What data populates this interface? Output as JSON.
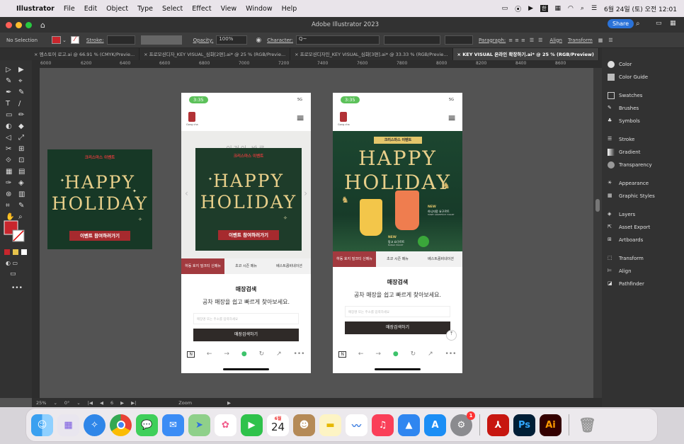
{
  "menubar": {
    "app": "Illustrator",
    "items": [
      "File",
      "Edit",
      "Object",
      "Type",
      "Select",
      "Effect",
      "View",
      "Window",
      "Help"
    ],
    "datetime": "6월 24일 (토) 오전 12:01"
  },
  "titlebar": {
    "title": "Adobe Illustrator 2023",
    "share": "Share"
  },
  "control": {
    "selection": "No Selection",
    "stroke": "Stroke:",
    "opacity_label": "Opacity:",
    "opacity": "100%",
    "character": "Character:",
    "char_search": "Q~",
    "paragraph": "Paragraph:",
    "align": "Align",
    "transform": "Transform"
  },
  "tabs": [
    "엠스토어 로고.ai @ 66.91 % (CMYK/Previe...",
    "프로모션디자_KEY VISUAL_심화[2편].ai* @ 25 % (RGB/Previe...",
    "프로모션디자인_KEY VISUAL_심화[3편].ai* @ 33.33 % (RGB/Previe...",
    "KEY VISUAL 온라인 확장하기.ai* @ 25 % (RGB/Preview)"
  ],
  "ruler": [
    "6000",
    "6200",
    "6400",
    "6600",
    "6800",
    "7000",
    "7200",
    "7400",
    "7600",
    "7800",
    "8000",
    "8200",
    "8400",
    "8600"
  ],
  "panels": [
    "Color",
    "Color Guide",
    "Swatches",
    "Brushes",
    "Symbols",
    "Stroke",
    "Gradient",
    "Transparency",
    "Appearance",
    "Graphic Styles",
    "Layers",
    "Asset Export",
    "Artboards",
    "Transform",
    "Align",
    "Pathfinder"
  ],
  "status": {
    "zoom": "25%",
    "rotate": "0°",
    "artboard": "6",
    "mode": "Zoom"
  },
  "kv": {
    "event": "크리스마스 이벤트",
    "happy": "HAPPY",
    "holiday": "HOLIDAY",
    "cta": "이벤트 참여하러가기"
  },
  "phone": {
    "time": "3:35",
    "network": "5G",
    "brand": "Gong cha",
    "hero_text": "이것이 바로",
    "menu_tabs": [
      "하동 호지 밀크티 신메뉴",
      "초코 시즌 메뉴",
      "베스트콤비네이션"
    ],
    "store_title": "매장검색",
    "store_sub": "공차 매장을 쉽고 빠르게 찾아보세요.",
    "store_placeholder": "매장명 또는 주소를 입력하세요",
    "store_btn": "매장검색하기",
    "new1": "NEW",
    "drink1": "하니자몽 요구르트",
    "drink1_sub": "HONEY GRAPEFRUIT YOGURT",
    "new2": "NEW",
    "drink2": "망고 요구르트",
    "drink2_sub": "MANGO YOGURT"
  },
  "dock": {
    "calendar_month": "6월",
    "calendar_day": "24",
    "badge": "1"
  }
}
